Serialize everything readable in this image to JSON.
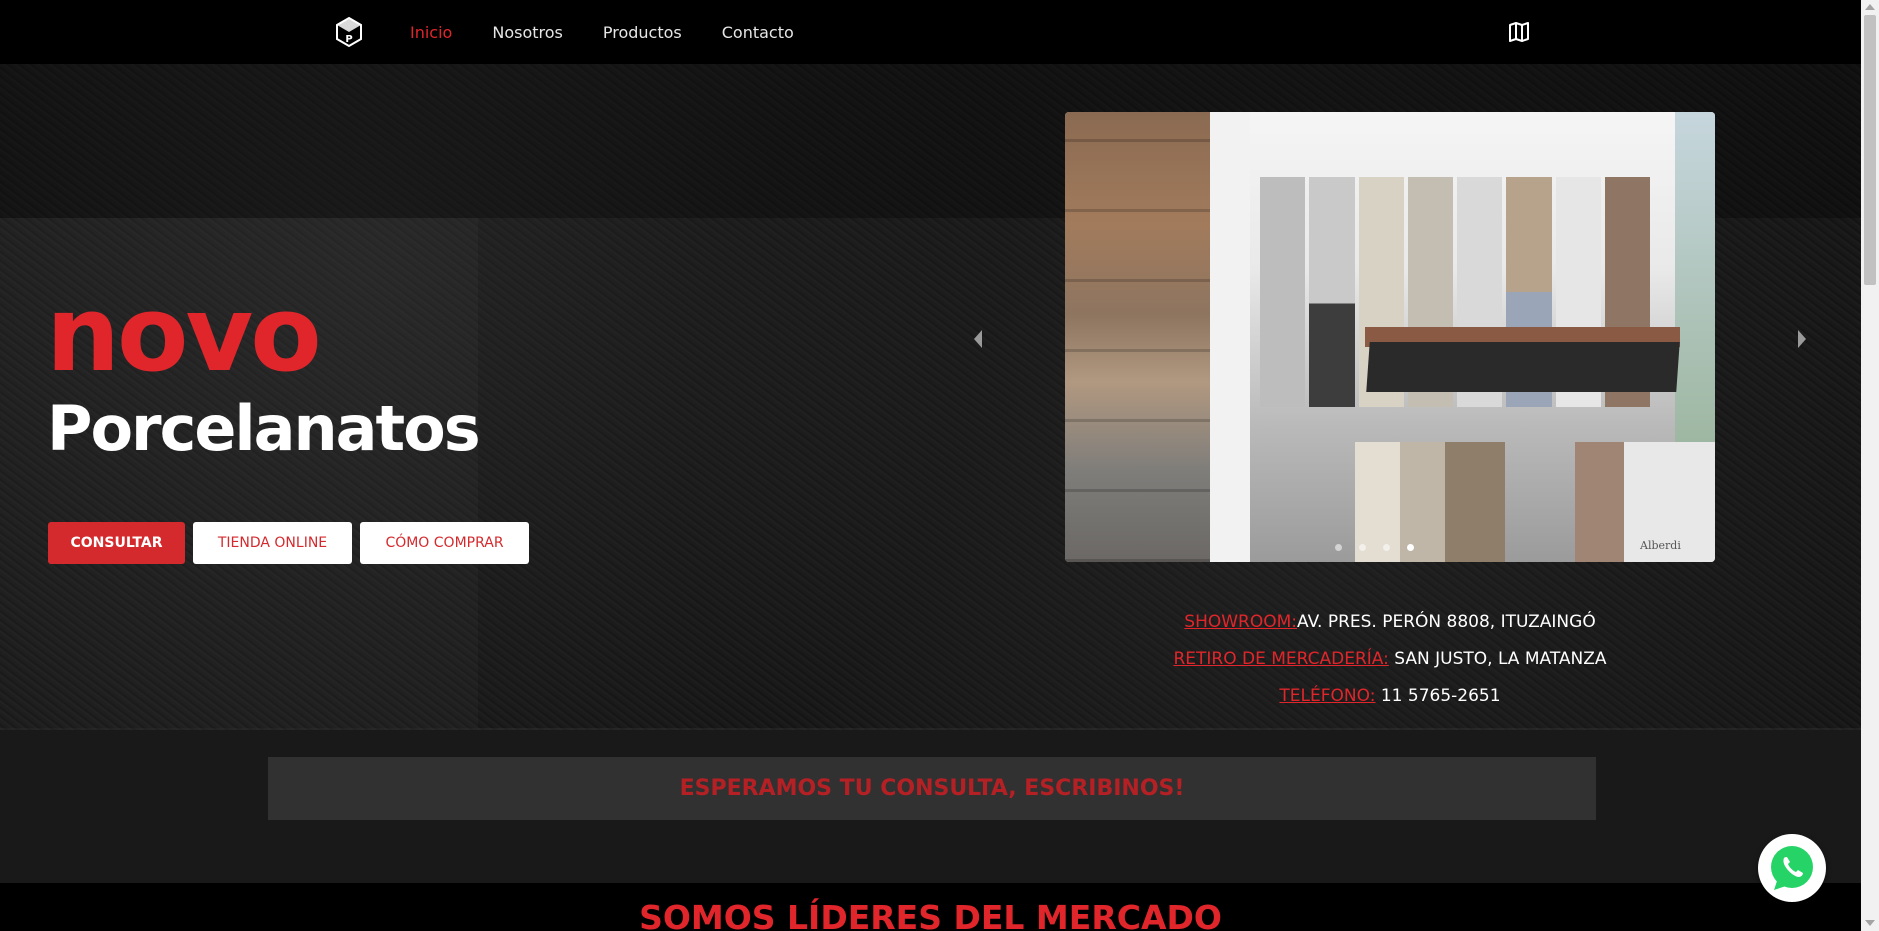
{
  "nav": {
    "logo_icon": "cube-p-logo-icon",
    "links": [
      {
        "label": "Inicio",
        "active": true
      },
      {
        "label": "Nosotros",
        "active": false
      },
      {
        "label": "Productos",
        "active": false
      },
      {
        "label": "Contacto",
        "active": false
      }
    ],
    "map_icon": "book-map-icon"
  },
  "hero": {
    "title_main": "novo",
    "title_sub": "Porcelanatos",
    "buttons": {
      "consultar": "CONSULTAR",
      "tienda": "TIENDA ONLINE",
      "como": "CÓMO COMPRAR"
    }
  },
  "carousel": {
    "watermark": "Alberdi",
    "dots": 4,
    "active_dot": 4
  },
  "info": {
    "showroom_label": "SHOWROOM:",
    "showroom_value": "AV. PRES. PERÓN 8808, ITUZAINGÓ",
    "retiro_label": "RETIRO DE MERCADERÍA:",
    "retiro_value": "SAN JUSTO, LA MATANZA",
    "telefono_label": "TELÉFONO:",
    "telefono_value": "11 5765-2651"
  },
  "banner": {
    "text": "ESPERAMOS TU CONSULTA, ESCRIBINOS!"
  },
  "section": {
    "title": "SOMOS LÍDERES DEL MERCADO"
  },
  "whatsapp": {
    "icon": "whatsapp-icon"
  },
  "colors": {
    "accent": "#e0262b",
    "nav_bg": "#000000"
  }
}
